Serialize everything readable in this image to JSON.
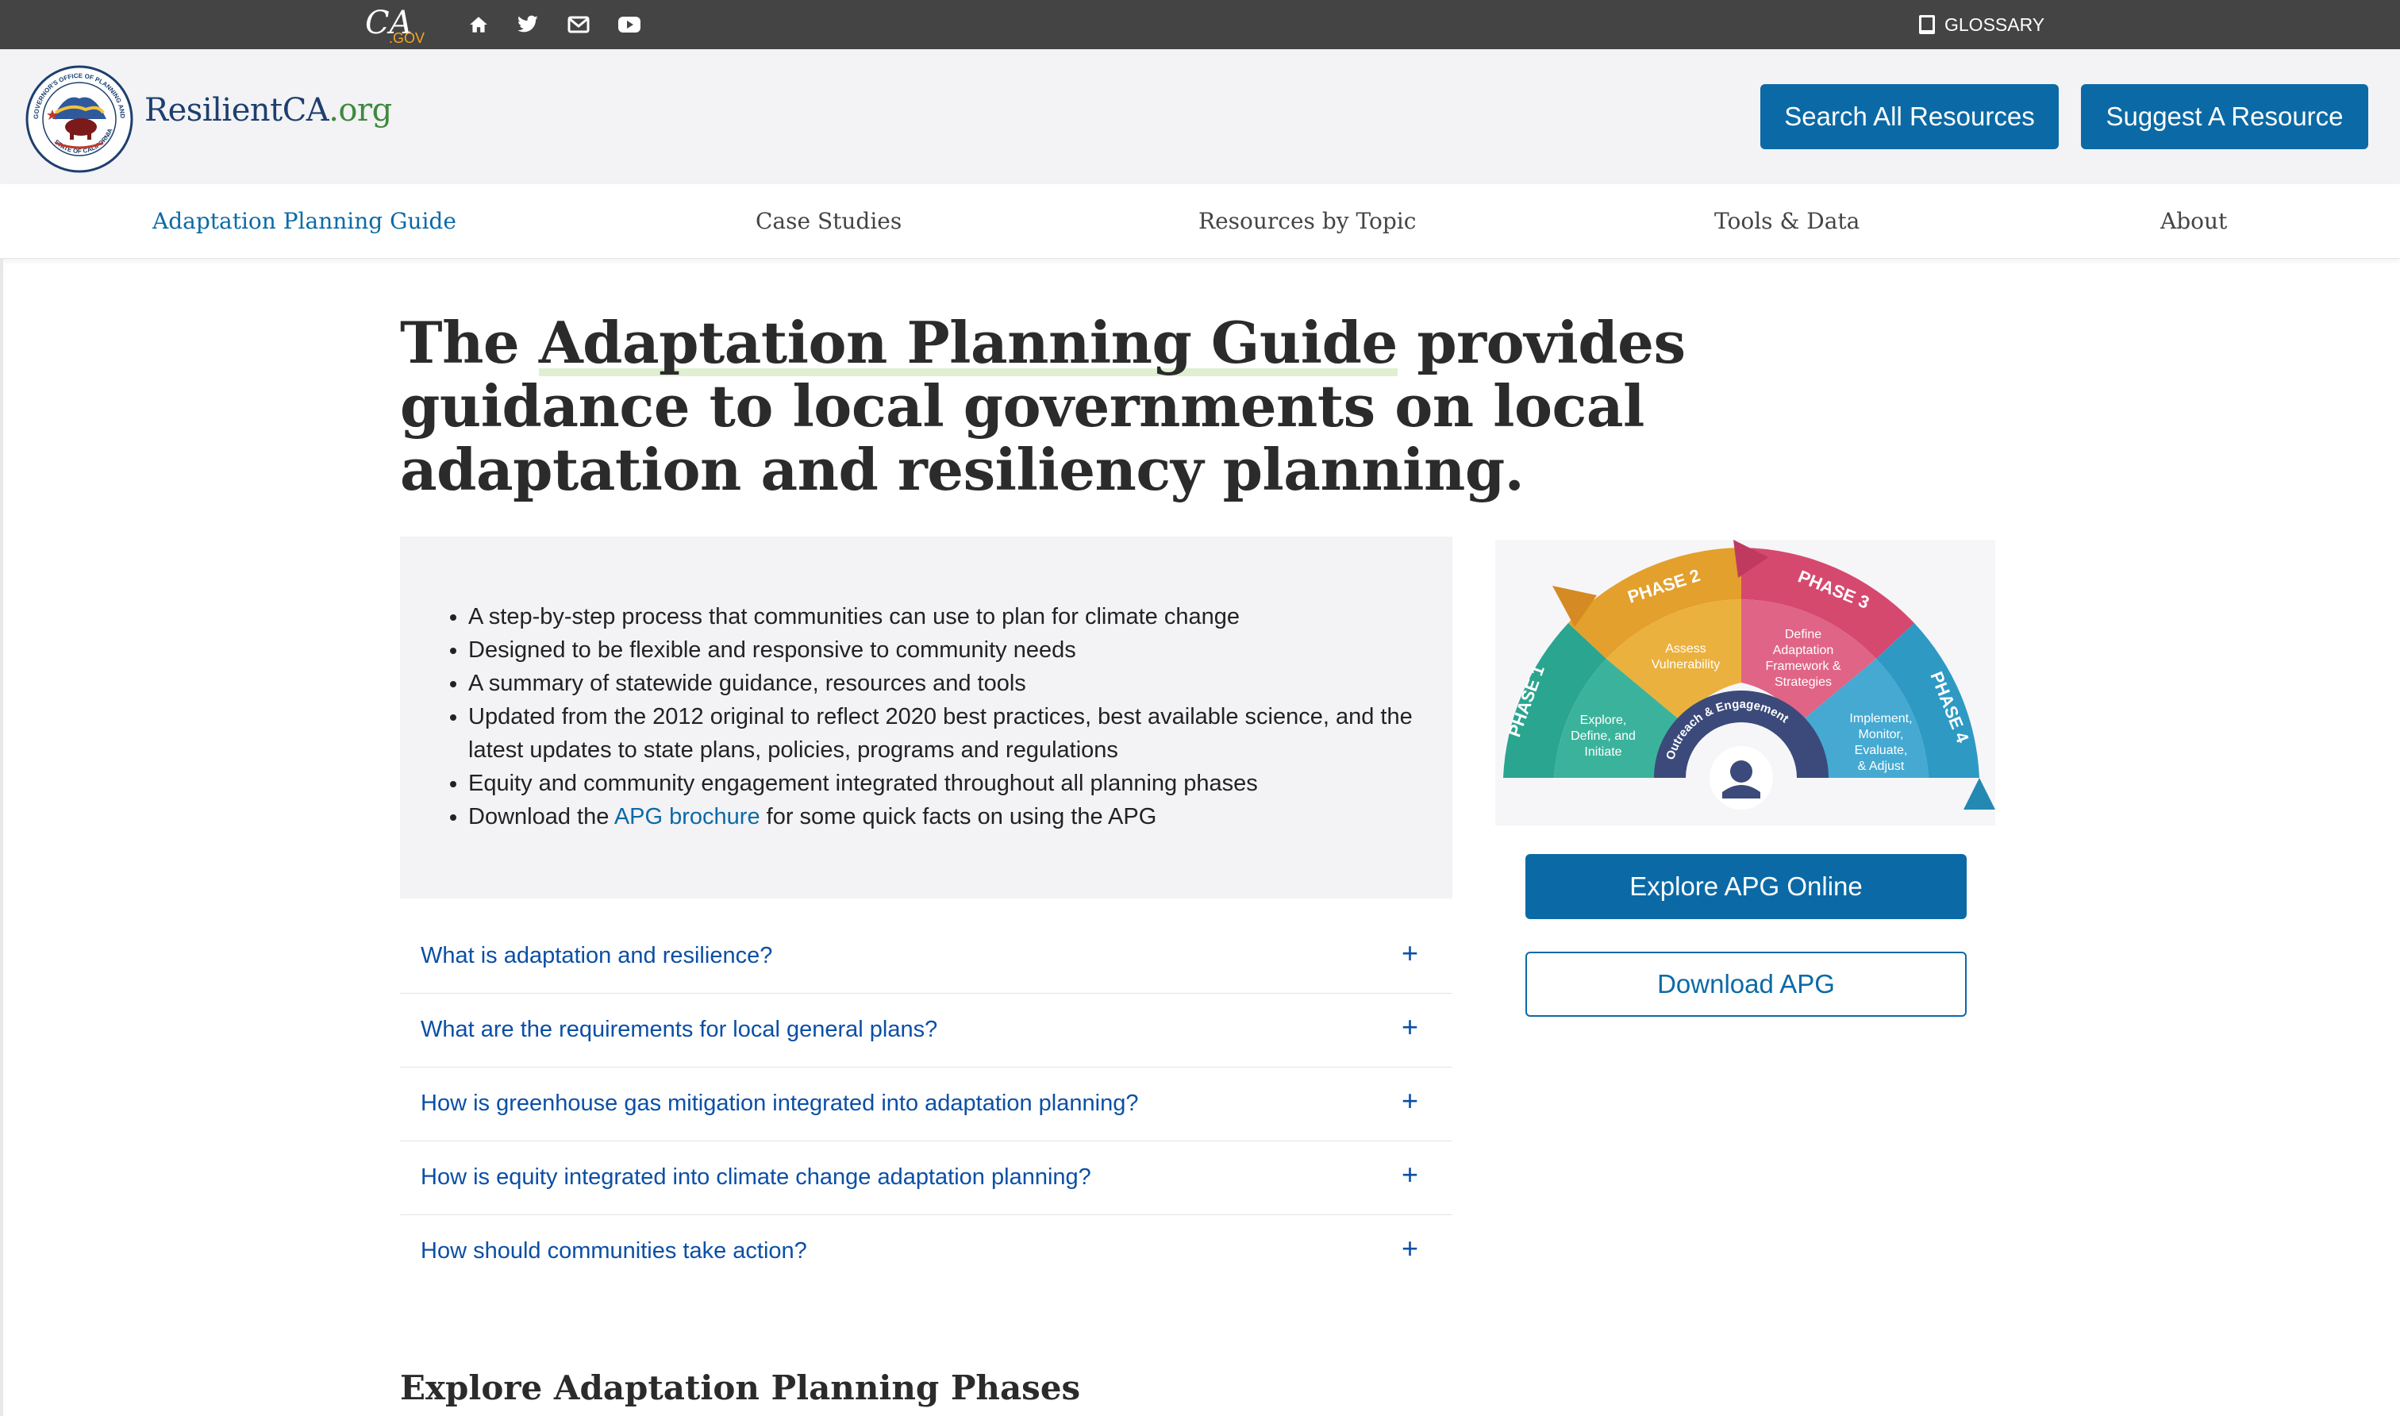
{
  "topbar": {
    "ca_logo_text": "CA",
    "ca_logo_sub": ".GOV",
    "icons": [
      "home-icon",
      "twitter-icon",
      "mail-icon",
      "youtube-icon"
    ],
    "glossary_label": "GLOSSARY"
  },
  "header": {
    "site_name": "ResilientCA",
    "site_tld": ".org",
    "seal_text_top": "GOVERNOR'S OFFICE OF PLANNING AND RESEARCH",
    "seal_text_bottom": "STATE OF CALIFORNIA",
    "search_button": "Search All Resources",
    "suggest_button": "Suggest A Resource"
  },
  "nav": {
    "items": [
      {
        "label": "Adaptation Planning Guide",
        "active": true
      },
      {
        "label": "Case Studies",
        "active": false
      },
      {
        "label": "Resources by Topic",
        "active": false
      },
      {
        "label": "Tools & Data",
        "active": false
      },
      {
        "label": "About",
        "active": false
      }
    ]
  },
  "hero": {
    "prefix": "The ",
    "highlight": "Adaptation Planning Guide",
    "suffix": " provides guidance to local governments on local adaptation and resiliency planning."
  },
  "info": {
    "bullets": [
      "A step-by-step process that communities can use to plan for climate change",
      "Designed to be flexible and responsive to community needs",
      "A summary of statewide guidance, resources and tools",
      "Updated from the 2012 original to reflect 2020 best practices, best available science, and the latest updates to state plans, policies, programs and regulations",
      "Equity and community engagement integrated throughout all planning phases"
    ],
    "download_prefix": "Download the ",
    "download_link": "APG brochure",
    "download_suffix": " for some quick facts on using the APG"
  },
  "accordion": [
    {
      "question": "What is adaptation and resilience?",
      "icon": "+"
    },
    {
      "question": "What are the requirements for local general plans?",
      "icon": "+"
    },
    {
      "question": "How is greenhouse gas mitigation integrated into adaptation planning?",
      "icon": "+"
    },
    {
      "question": "How is equity integrated into climate change adaptation planning?",
      "icon": "+"
    },
    {
      "question": "How should communities take action?",
      "icon": "+"
    }
  ],
  "diagram": {
    "phase1": "PHASE 1",
    "phase2": "PHASE 2",
    "phase3": "PHASE 3",
    "phase4": "PHASE 4",
    "p1_text": [
      "Explore,",
      "Define, and",
      "Initiate"
    ],
    "p2_text": [
      "Assess",
      "Vulnerability"
    ],
    "p3_text": [
      "Define",
      "Adaptation",
      "Framework &",
      "Strategies"
    ],
    "p4_text": [
      "Implement,",
      "Monitor,",
      "Evaluate,",
      "& Adjust"
    ],
    "center": "Outreach & Engagement",
    "colors": {
      "phase1": "#2aa58f",
      "phase2": "#e3a02c",
      "phase3": "#d6496f",
      "phase4": "#2e9ac4",
      "center": "#3b4a7a"
    }
  },
  "side": {
    "explore_button": "Explore APG Online",
    "download_button": "Download APG"
  },
  "section_title": "Explore Adaptation Planning Phases"
}
